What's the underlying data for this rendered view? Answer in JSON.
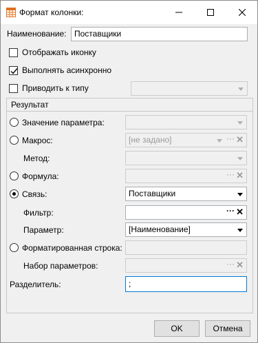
{
  "window": {
    "title": "Формат колонки:",
    "icon": "table-grid-icon",
    "controls": [
      "minimize-icon",
      "maximize-icon",
      "close-icon"
    ]
  },
  "name_field": {
    "label": "Наименование:",
    "value": "Поставщики"
  },
  "show_icon": {
    "label": "Отображать иконку",
    "checked": false
  },
  "async": {
    "label": "Выполнять асинхронно",
    "checked": true
  },
  "cast_type": {
    "label": "Приводить к типу",
    "checked": false,
    "value": ""
  },
  "result_group": {
    "title": "Результат",
    "param_value": {
      "label": "Значение параметра:",
      "selected": false,
      "value": ""
    },
    "macro": {
      "label": "Макрос:",
      "selected": false,
      "value": "[не задано]"
    },
    "method": {
      "label": "Метод:",
      "value": ""
    },
    "formula": {
      "label": "Формула:",
      "selected": false,
      "value": ""
    },
    "link": {
      "label": "Связь:",
      "selected": true,
      "value": "Поставщики"
    },
    "filter": {
      "label": "Фильтр:",
      "value": ""
    },
    "parameter": {
      "label": "Параметр:",
      "value": "[Наименование]"
    },
    "formatted_string": {
      "label": "Форматированная строка:",
      "selected": false,
      "value": ""
    },
    "param_set": {
      "label": "Набор параметров:",
      "value": ""
    },
    "separator": {
      "label": "Разделитель:",
      "value": ";"
    }
  },
  "buttons": {
    "ok": "OK",
    "cancel": "Отмена"
  },
  "colors": {
    "accent": "#0078d7",
    "window_bg": "#f0f0f0"
  }
}
